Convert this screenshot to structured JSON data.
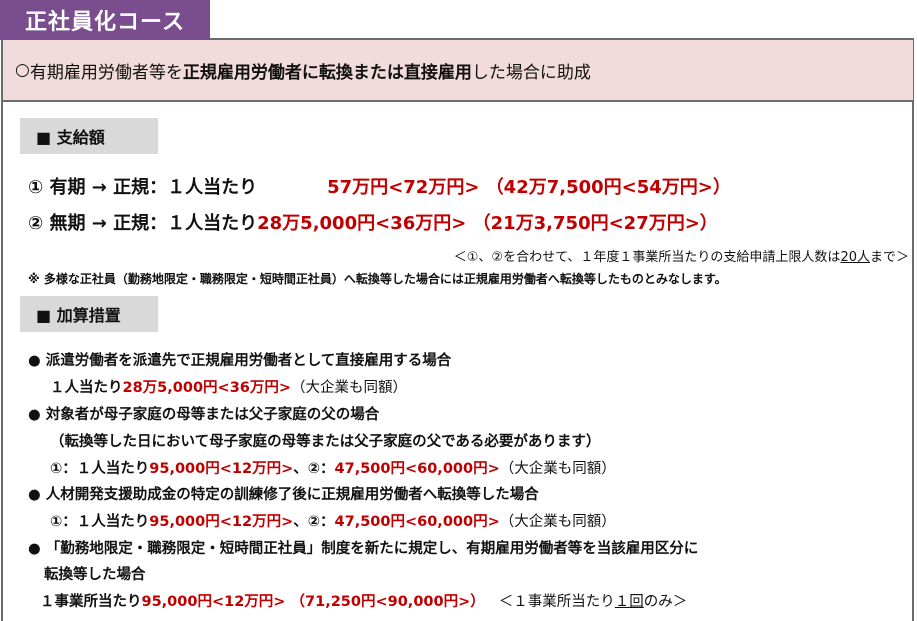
{
  "tab": {
    "title": "正社員化コース"
  },
  "banner": {
    "circle": "○",
    "pre": " 有期雇用労働者等を",
    "bold": "正規雇用労働者に転換または直接雇用",
    "post": "した場合に助成"
  },
  "support": {
    "heading": "■ 支給額",
    "row1": {
      "label": "① 有期 → 正規：１人当たり",
      "a": "57万円",
      "b": "<72万円>",
      "c": "（42万7,500円",
      "d": "<54万円>）"
    },
    "row2": {
      "label": "② 無期 → 正規：１人当たり",
      "a": "28万5,000円",
      "b": "<36万円>",
      "c": "（21万3,750円",
      "d": "<27万円>）"
    },
    "limit_pre": "＜①、②を合わせて、１年度１事業所当たりの支給申請上限人数は",
    "limit_u": "20人",
    "limit_post": "まで＞",
    "note": "※ 多様な正社員（勤務地限定・職務限定・短時間正社員）へ転換等した場合には正規雇用労働者へ転換等したものとみなします。"
  },
  "addition": {
    "heading": "■ 加算措置",
    "item1": {
      "title": "● 派遣労働者を派遣先で正規雇用労働者として直接雇用する場合",
      "l_pre": "１人当たり",
      "l_a": "28万5,000円",
      "l_b": "<36万円>",
      "l_post": "（大企業も同額）"
    },
    "item2": {
      "title": "● 対象者が母子家庭の母等または父子家庭の父の場合",
      "sub": "（転換等した日において母子家庭の母等または父子家庭の父である必要があります）",
      "l_pre": "①：１人当たり",
      "l_a": "95,000円",
      "l_b": "<12万円>",
      "l_mid": "、②：",
      "l_c": "47,500円",
      "l_d": "<60,000円>",
      "l_post": "（大企業も同額）"
    },
    "item3": {
      "title": "● 人材開発支援助成金の特定の訓練修了後に正規雇用労働者へ転換等した場合",
      "l_pre": "①：１人当たり",
      "l_a": "95,000円",
      "l_b": "<12万円>",
      "l_mid": "、②：",
      "l_c": "47,500円",
      "l_d": "<60,000円>",
      "l_post": "（大企業も同額）"
    },
    "item4": {
      "title1": "● 「勤務地限定・職務限定・短時間正社員」制度を新たに規定し、有期雇用労働者等を当該雇用区分に",
      "title2": "転換等した場合",
      "l_pre": "１事業所当たり",
      "l_a": "95,000円",
      "l_b": "<12万円>",
      "l_c": "（71,250円",
      "l_d": "<90,000円>）",
      "l_tail_pre": "＜１事業所当たり",
      "l_tail_u": "１回",
      "l_tail_post": "のみ＞"
    }
  }
}
